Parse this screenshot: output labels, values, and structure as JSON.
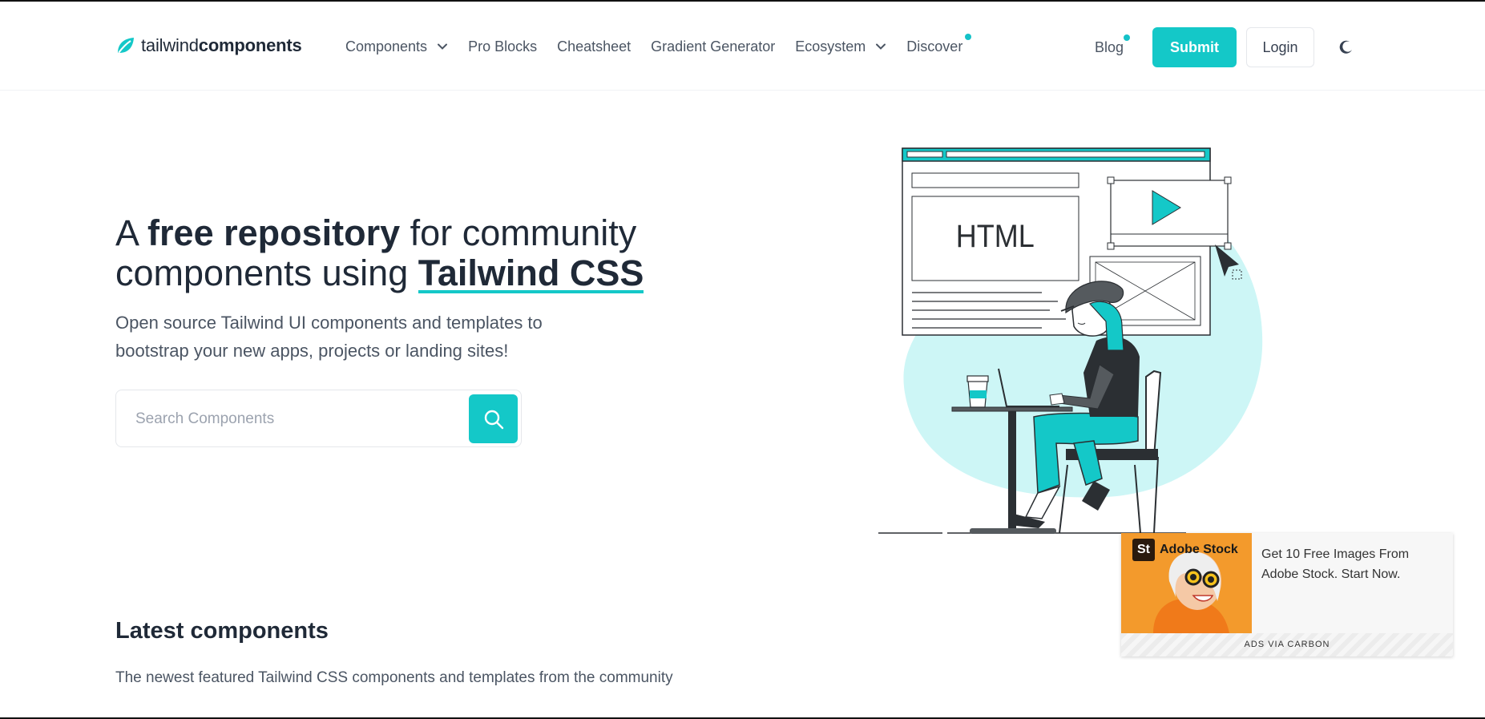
{
  "brand": {
    "light": "tailwind",
    "bold": "components",
    "accent_color": "#14c8c8"
  },
  "nav": {
    "items": [
      {
        "label": "Components",
        "dropdown": true,
        "badge": false
      },
      {
        "label": "Pro Blocks",
        "dropdown": false,
        "badge": false
      },
      {
        "label": "Cheatsheet",
        "dropdown": false,
        "badge": false
      },
      {
        "label": "Gradient Generator",
        "dropdown": false,
        "badge": false
      },
      {
        "label": "Ecosystem",
        "dropdown": true,
        "badge": false
      },
      {
        "label": "Discover",
        "dropdown": false,
        "badge": true
      }
    ],
    "blog": "Blog",
    "submit": "Submit",
    "login": "Login"
  },
  "hero": {
    "title_a": "A ",
    "title_bold": "free repository",
    "title_b": " for community components using ",
    "title_tw": "Tailwind CSS",
    "subtitle": "Open source Tailwind UI components and templates to bootstrap your new apps, projects or landing sites!",
    "search_placeholder": "Search Components"
  },
  "illustration": {
    "html_label": "HTML"
  },
  "latest": {
    "title": "Latest components",
    "subtitle": "The newest featured Tailwind CSS components and templates from the community"
  },
  "ad": {
    "brand_mark": "St",
    "brand_name": "Adobe Stock",
    "text": "Get 10 Free Images From Adobe Stock. Start Now.",
    "footer": "ADS VIA CARBON"
  }
}
